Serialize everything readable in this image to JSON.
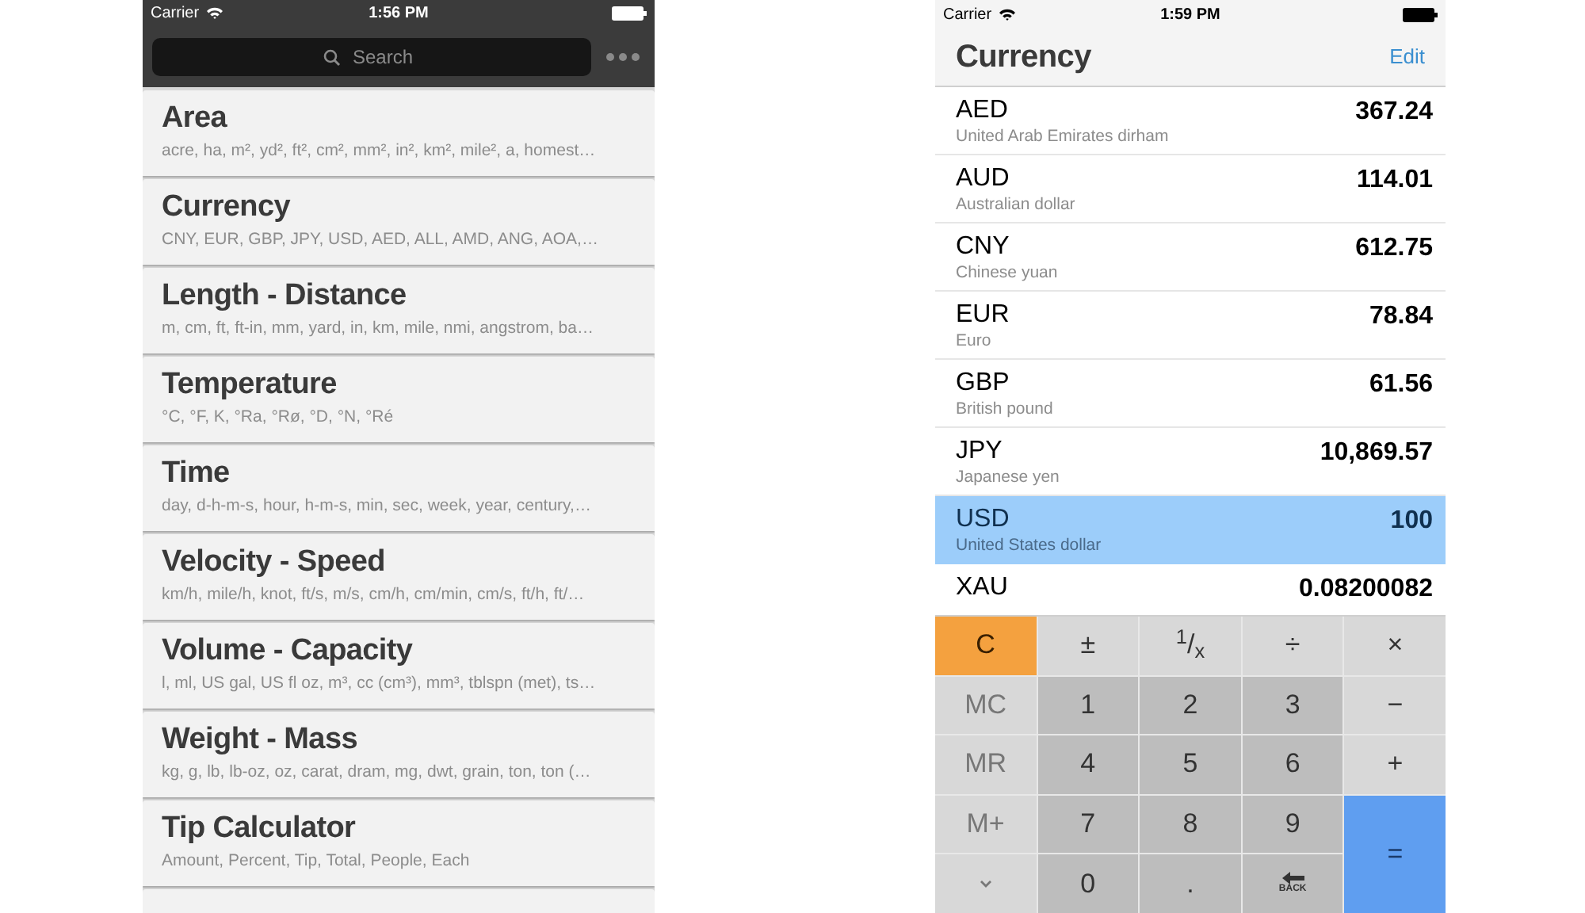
{
  "left_screen": {
    "status_bar": {
      "carrier": "Carrier",
      "time": "1:56 PM"
    },
    "search": {
      "placeholder": "Search"
    },
    "categories": [
      {
        "title": "Area",
        "units": "acre, ha, m², yd², ft², cm², mm², in², km², mile², a, homest…"
      },
      {
        "title": "Currency",
        "units": "CNY, EUR, GBP, JPY, USD, AED, ALL, AMD, ANG, AOA,…"
      },
      {
        "title": "Length - Distance",
        "units": "m, cm, ft, ft-in, mm, yard, in, km, mile, nmi, angstrom, ba…"
      },
      {
        "title": "Temperature",
        "units": "°C, °F, K, °Ra, °Rø, °D, °N, °Ré"
      },
      {
        "title": "Time",
        "units": "day, d-h-m-s, hour, h-m-s, min, sec, week, year, century,…"
      },
      {
        "title": "Velocity - Speed",
        "units": "km/h, mile/h, knot, ft/s, m/s, cm/h, cm/min, cm/s, ft/h, ft/…"
      },
      {
        "title": "Volume - Capacity",
        "units": "l, ml, US gal, US fl oz, m³, cc (cm³), mm³, tblspn (met), ts…"
      },
      {
        "title": "Weight - Mass",
        "units": "kg, g, lb, lb-oz, oz, carat, dram, mg, dwt, grain, ton, ton (…"
      },
      {
        "title": "Tip Calculator",
        "units": "Amount, Percent, Tip, Total, People, Each"
      }
    ]
  },
  "right_screen": {
    "status_bar": {
      "carrier": "Carrier",
      "time": "1:59 PM"
    },
    "title": "Currency",
    "edit": "Edit",
    "currencies": [
      {
        "code": "AED",
        "name": "United Arab Emirates dirham",
        "value": "367.24",
        "selected": false
      },
      {
        "code": "AUD",
        "name": "Australian dollar",
        "value": "114.01",
        "selected": false
      },
      {
        "code": "CNY",
        "name": "Chinese yuan",
        "value": "612.75",
        "selected": false
      },
      {
        "code": "EUR",
        "name": "Euro",
        "value": "78.84",
        "selected": false
      },
      {
        "code": "GBP",
        "name": "British pound",
        "value": "61.56",
        "selected": false
      },
      {
        "code": "JPY",
        "name": "Japanese yen",
        "value": "10,869.57",
        "selected": false
      },
      {
        "code": "USD",
        "name": "United States dollar",
        "value": "100",
        "selected": true
      },
      {
        "code": "XAU",
        "value": "0.08200082",
        "selected": false
      }
    ],
    "keypad": [
      {
        "kind": "clear",
        "label": "C"
      },
      {
        "kind": "op",
        "label": "±"
      },
      {
        "kind": "op",
        "label": "$^{1}$/$_{x}$"
      },
      {
        "kind": "op",
        "label": "÷"
      },
      {
        "kind": "op",
        "label": "×"
      },
      {
        "kind": "memory",
        "label": "MC"
      },
      {
        "kind": "digit",
        "label": "1"
      },
      {
        "kind": "digit",
        "label": "2"
      },
      {
        "kind": "digit",
        "label": "3"
      },
      {
        "kind": "op",
        "label": "−"
      },
      {
        "kind": "memory",
        "label": "MR"
      },
      {
        "kind": "digit",
        "label": "4"
      },
      {
        "kind": "digit",
        "label": "5"
      },
      {
        "kind": "digit",
        "label": "6"
      },
      {
        "kind": "op",
        "label": "+"
      },
      {
        "kind": "memory",
        "label": "M+"
      },
      {
        "kind": "digit",
        "label": "7"
      },
      {
        "kind": "digit",
        "label": "8"
      },
      {
        "kind": "digit",
        "label": "9"
      },
      {
        "kind": "equals",
        "label": "="
      },
      {
        "kind": "hide"
      },
      {
        "kind": "digit",
        "label": "0"
      },
      {
        "kind": "digit",
        "label": "."
      },
      {
        "kind": "back",
        "label": "BACK"
      }
    ]
  }
}
